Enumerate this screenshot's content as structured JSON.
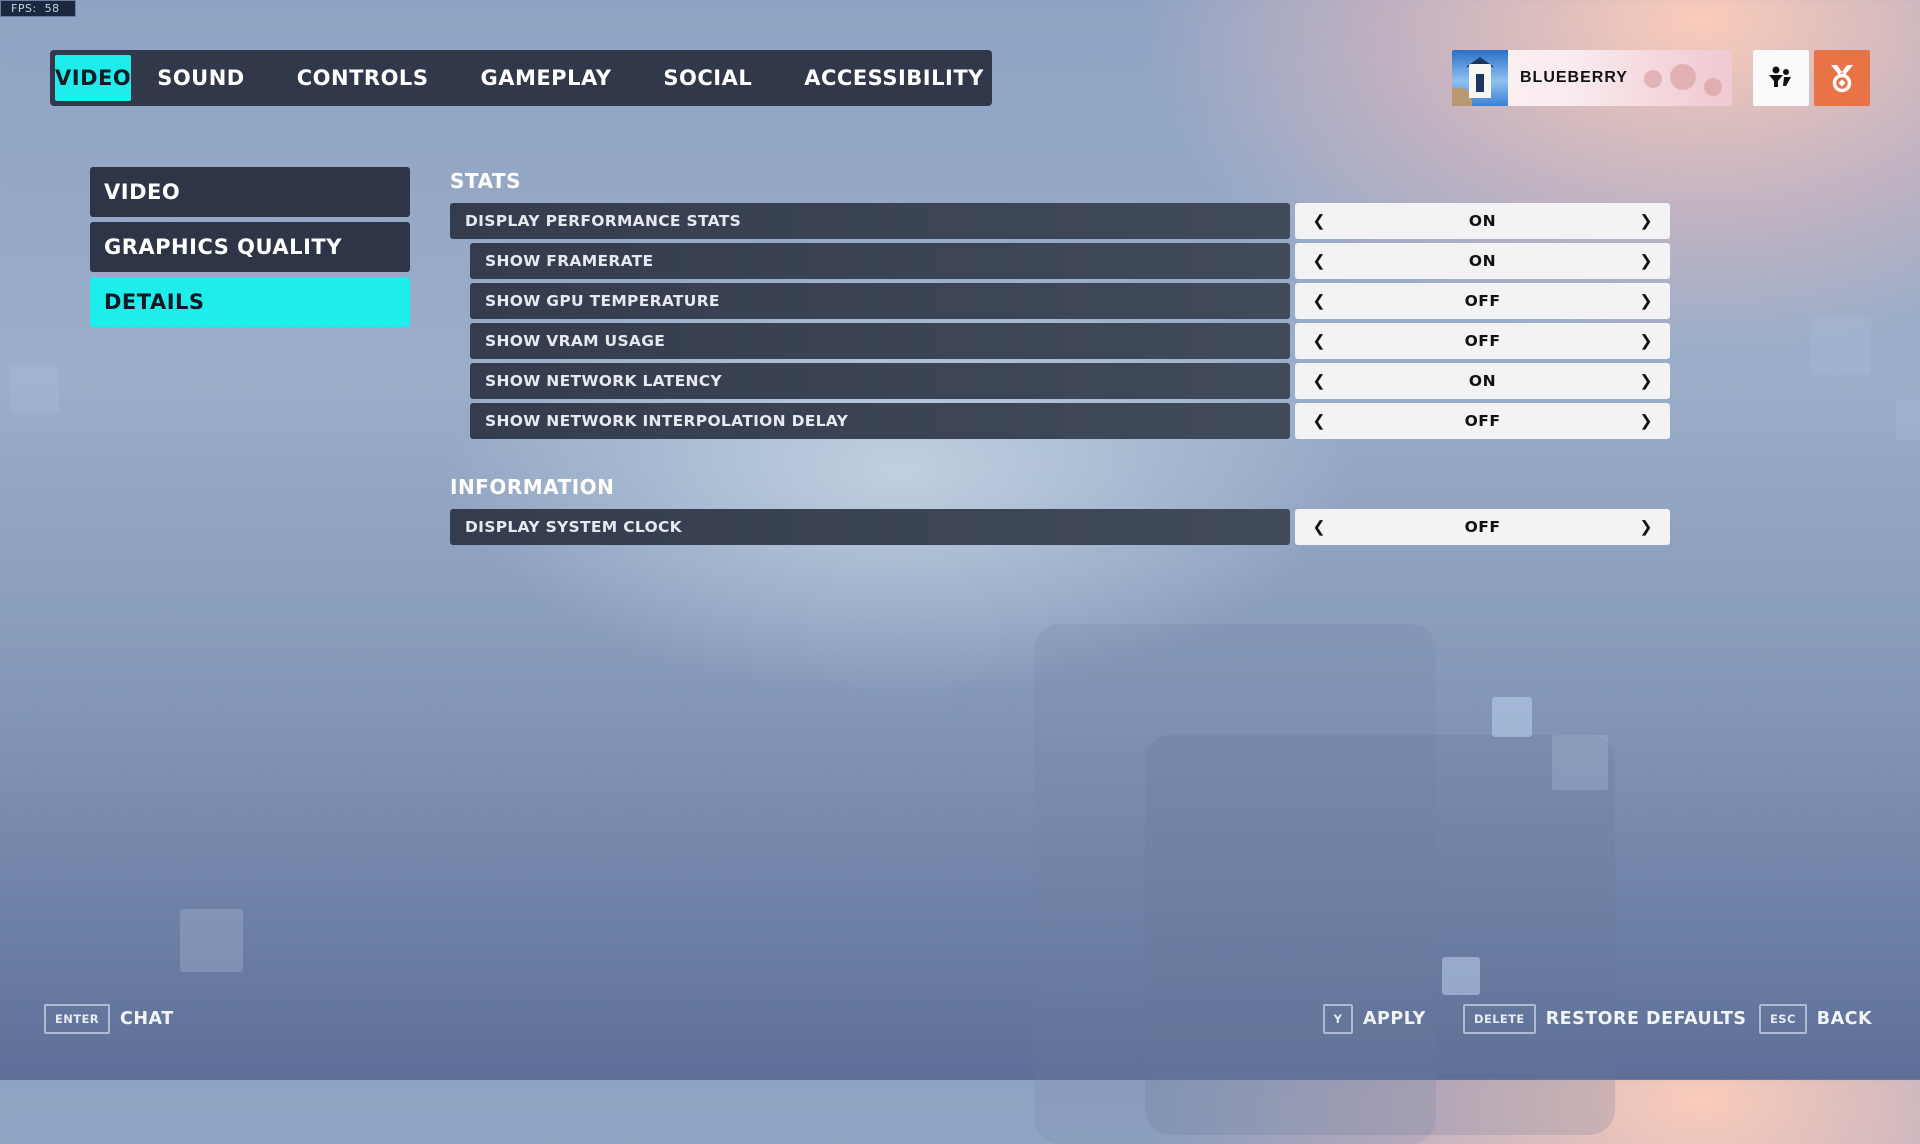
{
  "fps": {
    "label": "FPS:",
    "value": "58"
  },
  "top_nav": {
    "tabs": [
      {
        "label": "VIDEO",
        "active": true
      },
      {
        "label": "SOUND",
        "active": false
      },
      {
        "label": "CONTROLS",
        "active": false
      },
      {
        "label": "GAMEPLAY",
        "active": false
      },
      {
        "label": "SOCIAL",
        "active": false
      },
      {
        "label": "ACCESSIBILITY",
        "active": false
      }
    ]
  },
  "profile": {
    "name": "BLUEBERRY",
    "avatar_icon": "lighthouse-avatar",
    "group_icon": "group-icon",
    "reward_icon": "medal-icon",
    "reward_color": "#e87346"
  },
  "sidebar": {
    "items": [
      {
        "label": "VIDEO",
        "active": false
      },
      {
        "label": "GRAPHICS QUALITY",
        "active": false
      },
      {
        "label": "DETAILS",
        "active": true
      }
    ]
  },
  "sections": {
    "stats": {
      "title": "STATS",
      "rows": [
        {
          "label": "DISPLAY PERFORMANCE STATS",
          "value": "ON"
        },
        {
          "label": "SHOW FRAMERATE",
          "value": "ON"
        },
        {
          "label": "SHOW GPU TEMPERATURE",
          "value": "OFF"
        },
        {
          "label": "SHOW VRAM USAGE",
          "value": "OFF"
        },
        {
          "label": "SHOW NETWORK LATENCY",
          "value": "ON"
        },
        {
          "label": "SHOW NETWORK INTERPOLATION DELAY",
          "value": "OFF"
        }
      ]
    },
    "information": {
      "title": "INFORMATION",
      "rows": [
        {
          "label": "DISPLAY SYSTEM CLOCK",
          "value": "OFF"
        }
      ]
    }
  },
  "arrows": {
    "left": "❮",
    "right": "❯"
  },
  "footer": {
    "chat": {
      "key": "ENTER",
      "label": "CHAT"
    },
    "apply": {
      "key": "Y",
      "label": "APPLY"
    },
    "restore": {
      "key": "DELETE",
      "label": "RESTORE DEFAULTS"
    },
    "back": {
      "key": "ESC",
      "label": "BACK"
    }
  },
  "colors": {
    "accent": "#1deeec",
    "panel": "#303849",
    "value_bg": "#f3f3f5"
  }
}
